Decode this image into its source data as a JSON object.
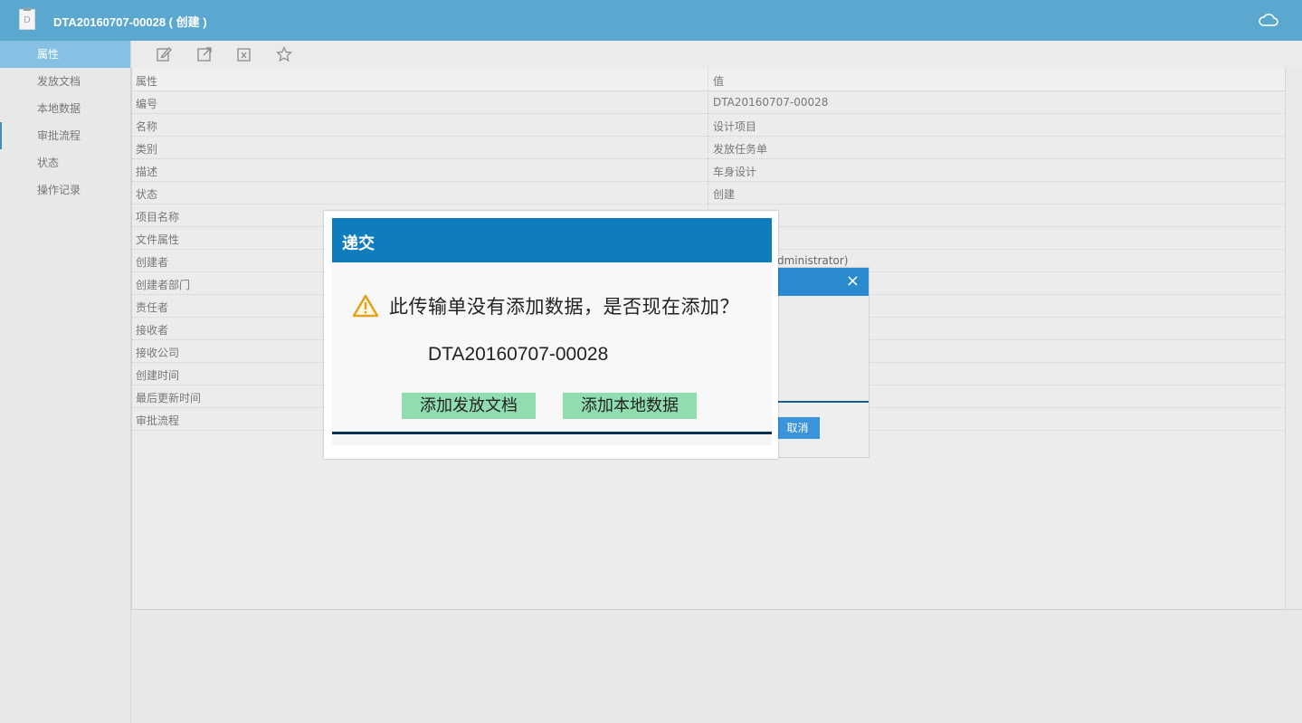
{
  "header": {
    "title": "DTA20160707-00028 ( 创建 )",
    "doc_icon_letter": "D"
  },
  "sidebar": {
    "items": [
      {
        "label": "属性"
      },
      {
        "label": "发放文档"
      },
      {
        "label": "本地数据"
      },
      {
        "label": "审批流程"
      },
      {
        "label": "状态"
      },
      {
        "label": "操作记录"
      }
    ]
  },
  "toolbar": {
    "icons": [
      "edit-icon",
      "external-link-icon",
      "delete-icon",
      "star-icon"
    ]
  },
  "table": {
    "headers": {
      "property": "属性",
      "value": "值"
    },
    "rows": [
      {
        "property": "编号",
        "value": "DTA20160707-00028"
      },
      {
        "property": "名称",
        "value": "设计项目"
      },
      {
        "property": "类别",
        "value": "发放任务单"
      },
      {
        "property": "描述",
        "value": "车身设计"
      },
      {
        "property": "状态",
        "value": "创建"
      },
      {
        "property": "项目名称",
        "value": ""
      },
      {
        "property": "文件属性",
        "value": ""
      },
      {
        "property": "创建者",
        "value": ""
      },
      {
        "property": "创建者部门",
        "value": ""
      },
      {
        "property": "责任者",
        "value": ""
      },
      {
        "property": "接收者",
        "value": ""
      },
      {
        "property": "接收公司",
        "value": ""
      },
      {
        "property": "创建时间",
        "value": ""
      },
      {
        "property": "最后更新时间",
        "value": ""
      },
      {
        "property": "审批流程",
        "value": ""
      }
    ],
    "creator_partial": "dministrator)"
  },
  "background_dialog": {
    "cancel_label": "取消"
  },
  "modal": {
    "title": "递交",
    "question": "此传输单没有添加数据，是否现在添加？",
    "doc_number": "DTA20160707-00028",
    "add_docs_button": "添加发放文档",
    "add_local_button": "添加本地数据"
  },
  "colors": {
    "header": "#5aa7d0",
    "sidebar_active": "#86c0e2",
    "modal_title_bar": "#0f7cbd",
    "green_button": "#90deb0"
  }
}
